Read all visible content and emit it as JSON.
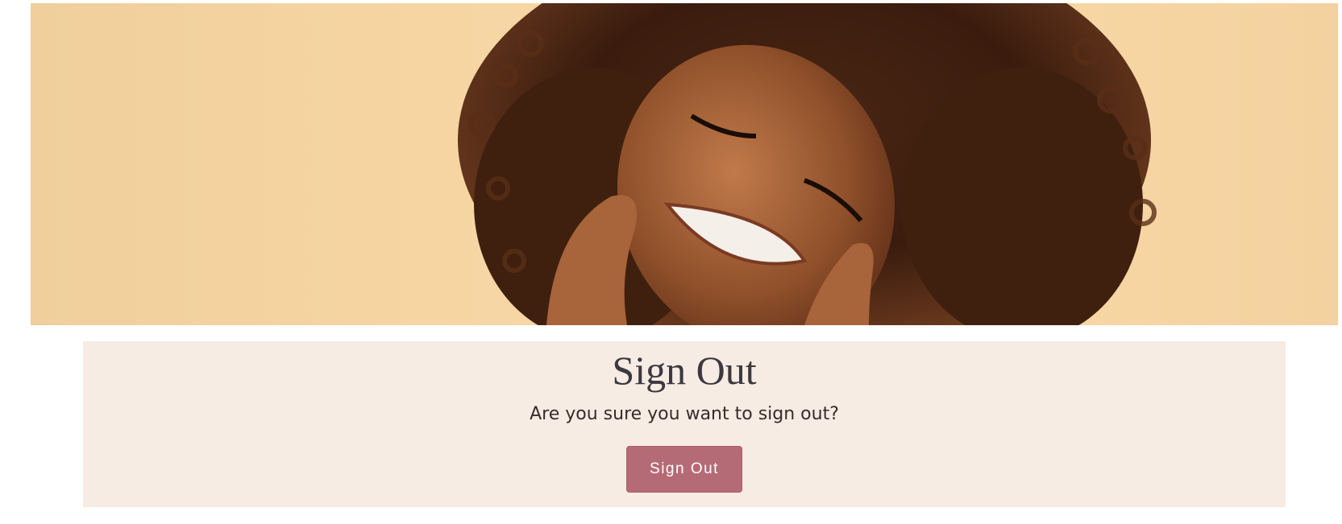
{
  "hero": {
    "image": "smiling-woman-curly-hair-photo",
    "background_color": "#f6d5a3"
  },
  "signout": {
    "title": "Sign Out",
    "question": "Are you sure you want to sign out?",
    "button_label": "Sign Out",
    "button_color": "#b56b76",
    "panel_color": "#f6ece3"
  }
}
